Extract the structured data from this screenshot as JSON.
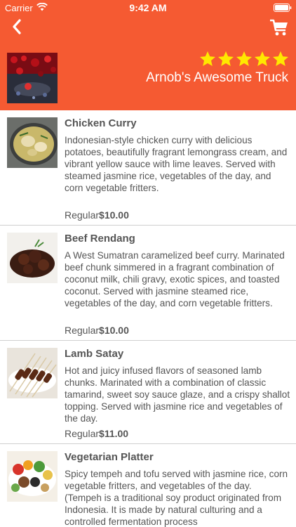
{
  "status_bar": {
    "carrier": "Carrier",
    "time": "9:42 AM"
  },
  "header": {
    "truck_name": "Arnob's Awesome Truck",
    "rating_stars": 5,
    "background_color": "#f55a32",
    "star_color": "#ffe800",
    "back_icon": "chevron-left-icon",
    "cart_icon": "shopping-cart-icon"
  },
  "menu": {
    "items": [
      {
        "name": "Chicken Curry",
        "description": "Indonesian-style chicken curry with delicious potatoes, beautifully fragrant lemongrass cream, and vibrant yellow sauce with lime leaves. Served with steamed jasmine rice, vegetables of the day, and corn vegetable fritters.",
        "price_label": "Regular",
        "price": "$10.00"
      },
      {
        "name": "Beef Rendang",
        "description": "A West Sumatran caramelized beef curry. Marinated beef chunk simmered in a fragrant combination of coconut milk, chili gravy, exotic spices, and toasted coconut. Served with jasmine steamed rice, vegetables of the day, and corn vegetable fritters.",
        "price_label": "Regular",
        "price": "$10.00"
      },
      {
        "name": "Lamb Satay",
        "description": "Hot and juicy infused flavors of seasoned lamb chunks. Marinated with a combination of classic tamarind, sweet soy sauce glaze, and a crispy shallot topping. Served with jasmine rice and vegetables of the day.",
        "price_label": "Regular",
        "price": "$11.00"
      },
      {
        "name": "Vegetarian Platter",
        "description": "Spicy tempeh and tofu served with jasmine rice, corn vegetable fritters, and vegetables of the day. (Tempeh is a traditional soy product originated from Indonesia. It is made by natural culturing and a controlled fermentation process"
      }
    ]
  }
}
